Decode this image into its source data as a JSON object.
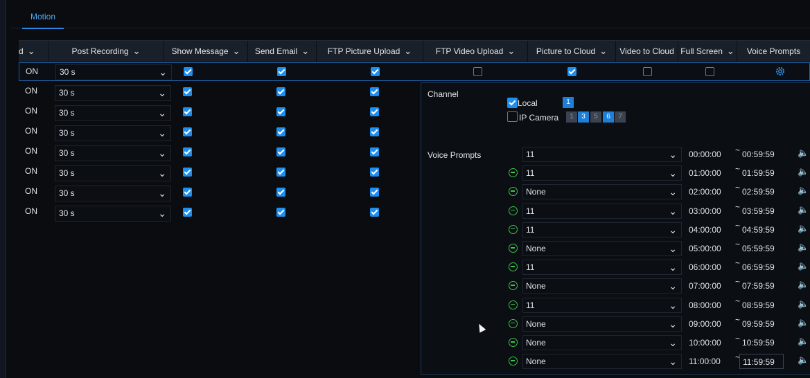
{
  "tabs": [
    {
      "label": "Motion",
      "active": true
    }
  ],
  "columns": [
    {
      "label": "d",
      "has_chevron": true
    },
    {
      "label": "Post Recording",
      "has_chevron": true
    },
    {
      "label": "Show Message",
      "has_chevron": true
    },
    {
      "label": "Send Email",
      "has_chevron": true
    },
    {
      "label": "FTP Picture Upload",
      "has_chevron": true
    },
    {
      "label": "FTP Video Upload",
      "has_chevron": true
    },
    {
      "label": "Picture to Cloud",
      "has_chevron": true
    },
    {
      "label": "Video to Cloud",
      "has_chevron": false
    },
    {
      "label": "Full Screen",
      "has_chevron": true
    },
    {
      "label": "Voice Prompts",
      "has_chevron": false
    }
  ],
  "selected_row": {
    "status": "ON",
    "post_recording": "30 s",
    "show_message": true,
    "send_email": true,
    "ftp_picture": true,
    "ftp_video": false,
    "picture_cloud": true,
    "video_cloud": false,
    "full_screen": false,
    "voice_prompts_icon": "gear-icon"
  },
  "rows": [
    {
      "status": "ON",
      "post_recording": "30 s",
      "show_message": true,
      "send_email": true,
      "ftp_picture": true
    },
    {
      "status": "ON",
      "post_recording": "30 s",
      "show_message": true,
      "send_email": true,
      "ftp_picture": true
    },
    {
      "status": "ON",
      "post_recording": "30 s",
      "show_message": true,
      "send_email": true,
      "ftp_picture": true
    },
    {
      "status": "ON",
      "post_recording": "30 s",
      "show_message": true,
      "send_email": true,
      "ftp_picture": true
    },
    {
      "status": "ON",
      "post_recording": "30 s",
      "show_message": true,
      "send_email": true,
      "ftp_picture": true
    },
    {
      "status": "ON",
      "post_recording": "30 s",
      "show_message": true,
      "send_email": true,
      "ftp_picture": true
    },
    {
      "status": "ON",
      "post_recording": "30 s",
      "show_message": true,
      "send_email": true,
      "ftp_picture": true
    }
  ],
  "panel": {
    "channel_label": "Channel",
    "local": {
      "label": "Local",
      "checked": true,
      "channels": [
        {
          "num": "1",
          "active": true
        }
      ]
    },
    "ip_camera": {
      "label": "IP Camera",
      "checked": false,
      "channels": [
        {
          "num": "1",
          "active": false
        },
        {
          "num": "3",
          "active": true
        },
        {
          "num": "5",
          "active": false
        },
        {
          "num": "6",
          "active": true
        },
        {
          "num": "7",
          "active": false
        }
      ]
    },
    "voice_prompts_label": "Voice Prompts",
    "schedule": [
      {
        "sound": "11",
        "start": "00:00:00",
        "end": "00:59:59",
        "removable": false,
        "speaker": "blue"
      },
      {
        "sound": "11",
        "start": "01:00:00",
        "end": "01:59:59",
        "removable": true,
        "speaker": "blue"
      },
      {
        "sound": "None",
        "start": "02:00:00",
        "end": "02:59:59",
        "removable": true,
        "speaker": "white"
      },
      {
        "sound": "11",
        "start": "03:00:00",
        "end": "03:59:59",
        "removable": true,
        "speaker": "blue"
      },
      {
        "sound": "11",
        "start": "04:00:00",
        "end": "04:59:59",
        "removable": true,
        "speaker": "blue"
      },
      {
        "sound": "None",
        "start": "05:00:00",
        "end": "05:59:59",
        "removable": true,
        "speaker": "white"
      },
      {
        "sound": "11",
        "start": "06:00:00",
        "end": "06:59:59",
        "removable": true,
        "speaker": "blue"
      },
      {
        "sound": "None",
        "start": "07:00:00",
        "end": "07:59:59",
        "removable": true,
        "speaker": "white"
      },
      {
        "sound": "11",
        "start": "08:00:00",
        "end": "08:59:59",
        "removable": true,
        "speaker": "blue"
      },
      {
        "sound": "None",
        "start": "09:00:00",
        "end": "09:59:59",
        "removable": true,
        "speaker": "white"
      },
      {
        "sound": "None",
        "start": "10:00:00",
        "end": "10:59:59",
        "removable": true,
        "speaker": "white"
      },
      {
        "sound": "None",
        "start": "11:00:00",
        "end": "11:59:59",
        "removable": true,
        "speaker": "white",
        "focused": true
      }
    ]
  },
  "colors": {
    "accent": "#1e8fef",
    "remove": "#3ec24c",
    "background": "#0a0c10",
    "header": "#1a2029"
  }
}
